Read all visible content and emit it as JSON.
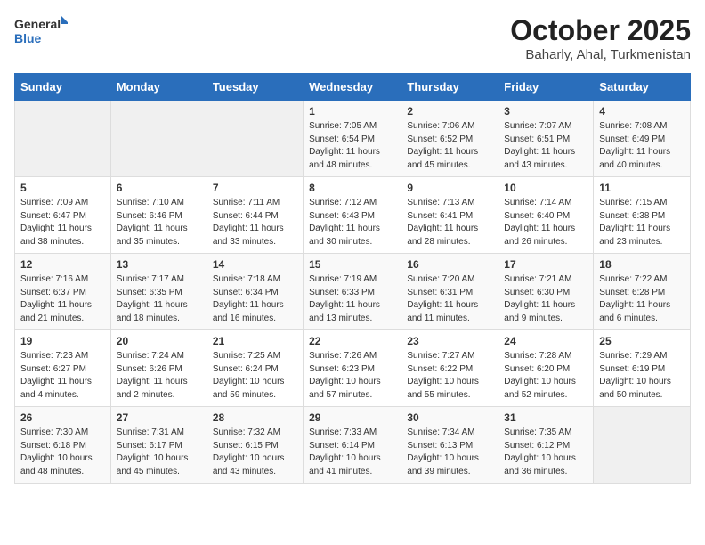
{
  "header": {
    "logo_general": "General",
    "logo_blue": "Blue",
    "title": "October 2025",
    "subtitle": "Baharly, Ahal, Turkmenistan"
  },
  "calendar": {
    "days_of_week": [
      "Sunday",
      "Monday",
      "Tuesday",
      "Wednesday",
      "Thursday",
      "Friday",
      "Saturday"
    ],
    "weeks": [
      {
        "cells": [
          {
            "day": "",
            "info": "",
            "empty": true
          },
          {
            "day": "",
            "info": "",
            "empty": true
          },
          {
            "day": "",
            "info": "",
            "empty": true
          },
          {
            "day": "1",
            "info": "Sunrise: 7:05 AM\nSunset: 6:54 PM\nDaylight: 11 hours and 48 minutes."
          },
          {
            "day": "2",
            "info": "Sunrise: 7:06 AM\nSunset: 6:52 PM\nDaylight: 11 hours and 45 minutes."
          },
          {
            "day": "3",
            "info": "Sunrise: 7:07 AM\nSunset: 6:51 PM\nDaylight: 11 hours and 43 minutes."
          },
          {
            "day": "4",
            "info": "Sunrise: 7:08 AM\nSunset: 6:49 PM\nDaylight: 11 hours and 40 minutes."
          }
        ]
      },
      {
        "cells": [
          {
            "day": "5",
            "info": "Sunrise: 7:09 AM\nSunset: 6:47 PM\nDaylight: 11 hours and 38 minutes."
          },
          {
            "day": "6",
            "info": "Sunrise: 7:10 AM\nSunset: 6:46 PM\nDaylight: 11 hours and 35 minutes."
          },
          {
            "day": "7",
            "info": "Sunrise: 7:11 AM\nSunset: 6:44 PM\nDaylight: 11 hours and 33 minutes."
          },
          {
            "day": "8",
            "info": "Sunrise: 7:12 AM\nSunset: 6:43 PM\nDaylight: 11 hours and 30 minutes."
          },
          {
            "day": "9",
            "info": "Sunrise: 7:13 AM\nSunset: 6:41 PM\nDaylight: 11 hours and 28 minutes."
          },
          {
            "day": "10",
            "info": "Sunrise: 7:14 AM\nSunset: 6:40 PM\nDaylight: 11 hours and 26 minutes."
          },
          {
            "day": "11",
            "info": "Sunrise: 7:15 AM\nSunset: 6:38 PM\nDaylight: 11 hours and 23 minutes."
          }
        ]
      },
      {
        "cells": [
          {
            "day": "12",
            "info": "Sunrise: 7:16 AM\nSunset: 6:37 PM\nDaylight: 11 hours and 21 minutes."
          },
          {
            "day": "13",
            "info": "Sunrise: 7:17 AM\nSunset: 6:35 PM\nDaylight: 11 hours and 18 minutes."
          },
          {
            "day": "14",
            "info": "Sunrise: 7:18 AM\nSunset: 6:34 PM\nDaylight: 11 hours and 16 minutes."
          },
          {
            "day": "15",
            "info": "Sunrise: 7:19 AM\nSunset: 6:33 PM\nDaylight: 11 hours and 13 minutes."
          },
          {
            "day": "16",
            "info": "Sunrise: 7:20 AM\nSunset: 6:31 PM\nDaylight: 11 hours and 11 minutes."
          },
          {
            "day": "17",
            "info": "Sunrise: 7:21 AM\nSunset: 6:30 PM\nDaylight: 11 hours and 9 minutes."
          },
          {
            "day": "18",
            "info": "Sunrise: 7:22 AM\nSunset: 6:28 PM\nDaylight: 11 hours and 6 minutes."
          }
        ]
      },
      {
        "cells": [
          {
            "day": "19",
            "info": "Sunrise: 7:23 AM\nSunset: 6:27 PM\nDaylight: 11 hours and 4 minutes."
          },
          {
            "day": "20",
            "info": "Sunrise: 7:24 AM\nSunset: 6:26 PM\nDaylight: 11 hours and 2 minutes."
          },
          {
            "day": "21",
            "info": "Sunrise: 7:25 AM\nSunset: 6:24 PM\nDaylight: 10 hours and 59 minutes."
          },
          {
            "day": "22",
            "info": "Sunrise: 7:26 AM\nSunset: 6:23 PM\nDaylight: 10 hours and 57 minutes."
          },
          {
            "day": "23",
            "info": "Sunrise: 7:27 AM\nSunset: 6:22 PM\nDaylight: 10 hours and 55 minutes."
          },
          {
            "day": "24",
            "info": "Sunrise: 7:28 AM\nSunset: 6:20 PM\nDaylight: 10 hours and 52 minutes."
          },
          {
            "day": "25",
            "info": "Sunrise: 7:29 AM\nSunset: 6:19 PM\nDaylight: 10 hours and 50 minutes."
          }
        ]
      },
      {
        "cells": [
          {
            "day": "26",
            "info": "Sunrise: 7:30 AM\nSunset: 6:18 PM\nDaylight: 10 hours and 48 minutes."
          },
          {
            "day": "27",
            "info": "Sunrise: 7:31 AM\nSunset: 6:17 PM\nDaylight: 10 hours and 45 minutes."
          },
          {
            "day": "28",
            "info": "Sunrise: 7:32 AM\nSunset: 6:15 PM\nDaylight: 10 hours and 43 minutes."
          },
          {
            "day": "29",
            "info": "Sunrise: 7:33 AM\nSunset: 6:14 PM\nDaylight: 10 hours and 41 minutes."
          },
          {
            "day": "30",
            "info": "Sunrise: 7:34 AM\nSunset: 6:13 PM\nDaylight: 10 hours and 39 minutes."
          },
          {
            "day": "31",
            "info": "Sunrise: 7:35 AM\nSunset: 6:12 PM\nDaylight: 10 hours and 36 minutes."
          },
          {
            "day": "",
            "info": "",
            "empty": true
          }
        ]
      }
    ]
  }
}
